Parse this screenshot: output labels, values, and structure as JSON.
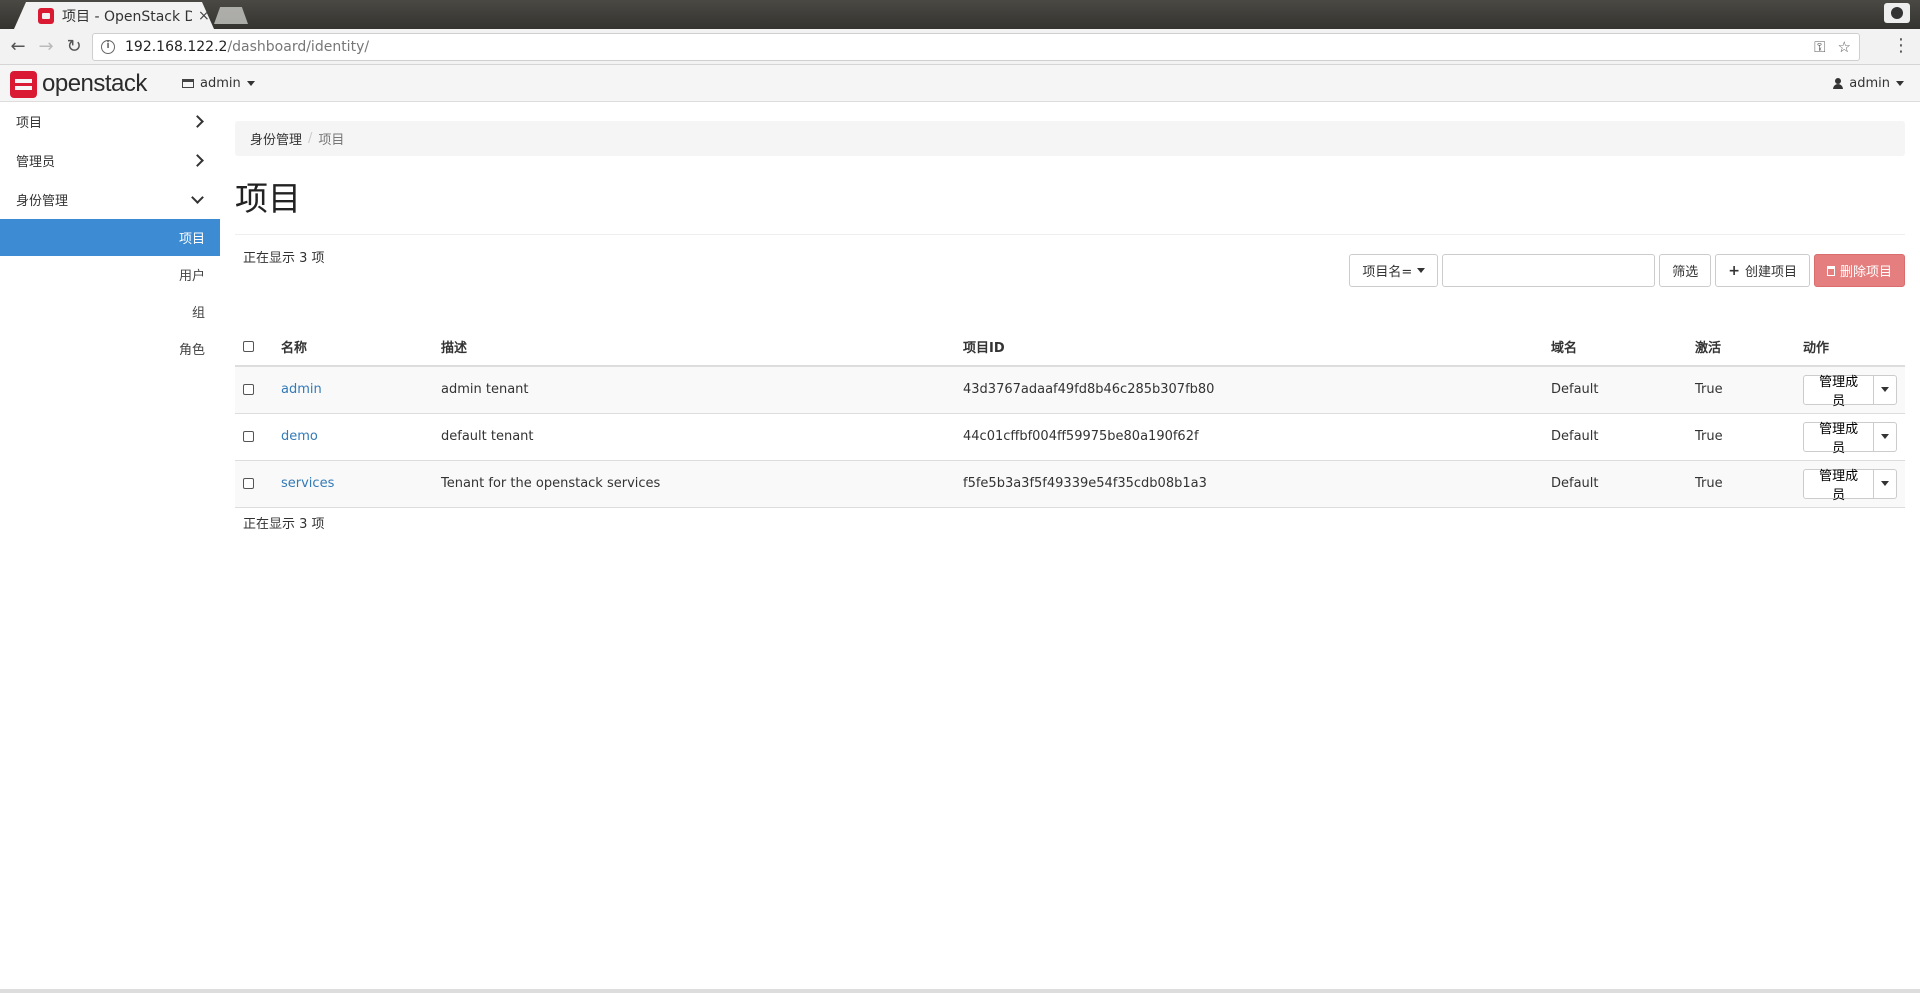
{
  "browser": {
    "tab_title": "项目 - OpenStack Dashboard",
    "tab_close": "×",
    "url_host": "192.168.122.2",
    "url_path": "/dashboard/identity/"
  },
  "header": {
    "logo_text": "openstack",
    "project_selector": "admin",
    "user_menu": "admin"
  },
  "sidebar": {
    "groups": [
      {
        "label": "项目"
      },
      {
        "label": "管理员"
      },
      {
        "label": "身份管理"
      }
    ],
    "items": [
      {
        "label": "项目"
      },
      {
        "label": "用户"
      },
      {
        "label": "组"
      },
      {
        "label": "角色"
      }
    ]
  },
  "breadcrumb": {
    "parent": "身份管理",
    "separator": "/",
    "current": "项目"
  },
  "page_title": "项目",
  "toolbar": {
    "filter_field": "项目名=",
    "filter_value": "",
    "filter_button": "筛选",
    "create_button": "创建项目",
    "delete_button": "删除项目"
  },
  "table": {
    "count_text": "正在显示 3 项",
    "columns": [
      "名称",
      "描述",
      "项目ID",
      "域名",
      "激活",
      "动作"
    ],
    "rows": [
      {
        "name": "admin",
        "description": "admin tenant",
        "id": "43d3767adaaf49fd8b46c285b307fb80",
        "domain": "Default",
        "enabled": "True",
        "action": "管理成员"
      },
      {
        "name": "demo",
        "description": "default tenant",
        "id": "44c01cffbf004ff59975be80a190f62f",
        "domain": "Default",
        "enabled": "True",
        "action": "管理成员"
      },
      {
        "name": "services",
        "description": "Tenant for the openstack services",
        "id": "f5fe5b3a3f5f49339e54f35cdb08b1a3",
        "domain": "Default",
        "enabled": "True",
        "action": "管理成员"
      }
    ]
  },
  "colors": {
    "accent": "#3d8bd3",
    "brand": "#da1a32",
    "danger": "#e57f7f",
    "link": "#337ab7"
  }
}
